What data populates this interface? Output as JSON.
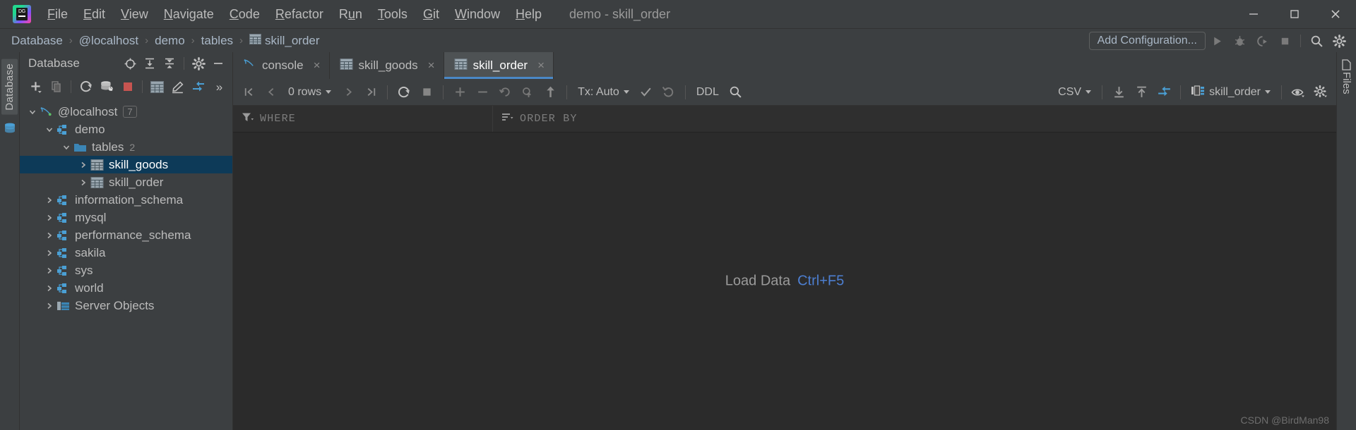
{
  "window": {
    "title": "demo - skill_order",
    "logo_text": "DG",
    "controls": [
      {
        "name": "minimize",
        "glyph": "minimize-icon"
      },
      {
        "name": "maximize",
        "glyph": "maximize-icon"
      },
      {
        "name": "close",
        "glyph": "close-icon"
      }
    ]
  },
  "menu": [
    {
      "label": "File",
      "mnemonic": "F"
    },
    {
      "label": "Edit",
      "mnemonic": "E"
    },
    {
      "label": "View",
      "mnemonic": "V"
    },
    {
      "label": "Navigate",
      "mnemonic": "N"
    },
    {
      "label": "Code",
      "mnemonic": "C"
    },
    {
      "label": "Refactor",
      "mnemonic": "R"
    },
    {
      "label": "Run",
      "mnemonic": "u"
    },
    {
      "label": "Tools",
      "mnemonic": "T"
    },
    {
      "label": "Git",
      "mnemonic": "G"
    },
    {
      "label": "Window",
      "mnemonic": "W"
    },
    {
      "label": "Help",
      "mnemonic": "H"
    }
  ],
  "breadcrumb": {
    "separator": "›",
    "items": [
      {
        "label": "Database",
        "icon": ""
      },
      {
        "label": "@localhost",
        "icon": ""
      },
      {
        "label": "demo",
        "icon": ""
      },
      {
        "label": "tables",
        "icon": ""
      },
      {
        "label": "skill_order",
        "icon": "table-icon"
      }
    ]
  },
  "navbar": {
    "add_configuration": "Add Configuration...",
    "icons": [
      "run-icon",
      "debug-icon",
      "run-with-coverage-icon",
      "stop-icon",
      "search-everywhere-icon",
      "settings-icon"
    ]
  },
  "left_strip": {
    "label": "Database",
    "icon": "database-stack-icon"
  },
  "right_strip": {
    "label": "Files"
  },
  "db_panel": {
    "title": "Database",
    "header_icons": [
      "locate-icon",
      "expand-all-icon",
      "collapse-all-icon",
      "settings-icon",
      "hide-icon"
    ],
    "toolbar_icons": [
      "add-icon",
      "copy-icon",
      "refresh-icon",
      "datasource-properties-icon",
      "stop-icon",
      "table-icon",
      "edit-icon",
      "jump-to-icon",
      "more-icon"
    ],
    "tree": [
      {
        "label": "@localhost",
        "badge": "7",
        "icon": "mysql-icon",
        "expanded": true,
        "indent": 0,
        "selected": false
      },
      {
        "label": "demo",
        "badge": "",
        "icon": "schema-icon",
        "expanded": true,
        "indent": 1,
        "selected": false
      },
      {
        "label": "tables",
        "badge": "2",
        "icon": "folder-icon",
        "expanded": true,
        "indent": 2,
        "selected": false
      },
      {
        "label": "skill_goods",
        "badge": "",
        "icon": "table-icon",
        "expanded": false,
        "indent": 3,
        "selected": true
      },
      {
        "label": "skill_order",
        "badge": "",
        "icon": "table-icon",
        "expanded": false,
        "indent": 3,
        "selected": false
      },
      {
        "label": "information_schema",
        "badge": "",
        "icon": "schema-icon",
        "expanded": false,
        "indent": 1,
        "selected": false
      },
      {
        "label": "mysql",
        "badge": "",
        "icon": "schema-icon",
        "expanded": false,
        "indent": 1,
        "selected": false
      },
      {
        "label": "performance_schema",
        "badge": "",
        "icon": "schema-icon",
        "expanded": false,
        "indent": 1,
        "selected": false
      },
      {
        "label": "sakila",
        "badge": "",
        "icon": "schema-icon",
        "expanded": false,
        "indent": 1,
        "selected": false
      },
      {
        "label": "sys",
        "badge": "",
        "icon": "schema-icon",
        "expanded": false,
        "indent": 1,
        "selected": false
      },
      {
        "label": "world",
        "badge": "",
        "icon": "schema-icon",
        "expanded": false,
        "indent": 1,
        "selected": false
      },
      {
        "label": "Server Objects",
        "badge": "",
        "icon": "server-objects-icon",
        "expanded": false,
        "indent": 1,
        "selected": false
      }
    ]
  },
  "tabs": [
    {
      "label": "console",
      "icon": "mysql-icon",
      "active": false,
      "close": "×"
    },
    {
      "label": "skill_goods",
      "icon": "table-icon",
      "active": false,
      "close": "×"
    },
    {
      "label": "skill_order",
      "icon": "table-icon",
      "active": true,
      "close": "×"
    }
  ],
  "grid_toolbar": {
    "first_page": "first-page-icon",
    "prev_page": "prev-page-icon",
    "rows_label": "0 rows",
    "next_page": "next-page-icon",
    "last_page": "last-page-icon",
    "reload": "reload-icon",
    "cancel": "stop-icon",
    "add_row": "add-row-icon",
    "delete_row": "delete-row-icon",
    "revert": "revert-icon",
    "revert_selected": "revert-selected-icon",
    "submit": "submit-icon",
    "tx_label": "Tx: Auto",
    "commit": "commit-icon",
    "rollback": "rollback-icon",
    "ddl_label": "DDL",
    "search_icon": "search-icon",
    "csv_label": "CSV",
    "export_icon": "export-icon",
    "import_icon": "import-icon",
    "jump_icon": "jump-to-icon",
    "table_selector": "skill_order",
    "preview_icon": "eye-icon",
    "settings_icon": "gear-icon"
  },
  "filter_bar": {
    "where_label": "WHERE",
    "where_icon": "filter-icon",
    "order_label": "ORDER BY",
    "order_icon": "sort-icon"
  },
  "canvas": {
    "load_text": "Load Data",
    "load_shortcut": "Ctrl+F5",
    "watermark": "CSDN @BirdMan98"
  },
  "colors": {
    "accent_blue": "#4a88c7",
    "link_blue": "#4d7fd1",
    "selection": "#0d3a58",
    "panel_bg": "#3c3f41",
    "editor_bg": "#2b2b2b",
    "text": "#bbbbbb",
    "stop_red": "#c75450",
    "icon_blue": "#4a9fd4"
  }
}
